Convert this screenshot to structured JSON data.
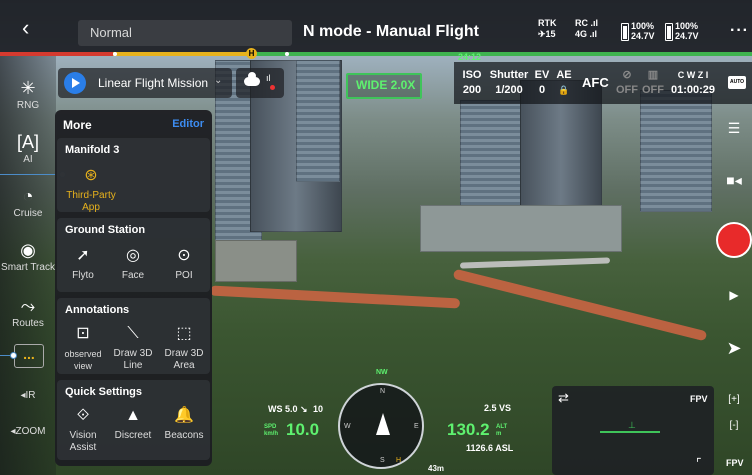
{
  "header": {
    "back_icon": "chevron-left-icon",
    "mode_value": "Normal",
    "flight_mode": "N mode - Manual Flight",
    "rtk_label": "RTK",
    "rtk_count": "15",
    "rc_label": "RC",
    "rc_network": "4G",
    "battery1_pct": "100%",
    "battery1_volt": "24.7V",
    "battery2_pct": "100%",
    "battery2_volt": "24.7V",
    "more_icon": "ellipsis-icon"
  },
  "progress": {
    "home_marker": "H",
    "flight_time": "24:12",
    "segment_colors": [
      "#d63a2f",
      "#e8b21c",
      "#3fb34f"
    ]
  },
  "mission": {
    "label": "Linear Flight Mission",
    "play_icon": "play-icon"
  },
  "camera": {
    "zoom_badge": "WIDE 2.0X",
    "iso_label": "ISO",
    "iso_value": "200",
    "shutter_label": "Shutter",
    "shutter_value": "1/200",
    "ev_label": "EV",
    "ev_value": "0",
    "ae_label": "AE",
    "ae_value": "🔒",
    "af_mode": "AFC",
    "off1": "OFF",
    "off2": "OFF",
    "storage_label": "C W Z I",
    "record_time": "01:00:29",
    "auto_label": "AUTO"
  },
  "left_toolbar": {
    "rng": "RNG",
    "ai": "AI",
    "cruise": "Cruise",
    "smart_track": "Smart Track",
    "routes": "Routes",
    "more_dots": "...",
    "ir": "IR",
    "zoom": "ZOOM"
  },
  "more_panel": {
    "title": "More",
    "editor": "Editor",
    "manifold": {
      "title": "Manifold 3",
      "items": [
        {
          "label": "Third-Party App",
          "icon": "third-party-app-icon"
        }
      ]
    },
    "ground_station": {
      "title": "Ground Station",
      "items": [
        {
          "label": "Flyto",
          "icon": "flyto-icon"
        },
        {
          "label": "Face",
          "icon": "eye-icon"
        },
        {
          "label": "POI",
          "icon": "poi-icon"
        }
      ]
    },
    "annotations": {
      "title": "Annotations",
      "items": [
        {
          "label": "observed view",
          "icon": "observed-view-icon"
        },
        {
          "label": "Draw 3D Line",
          "icon": "draw-line-icon"
        },
        {
          "label": "Draw 3D Area",
          "icon": "draw-area-icon"
        }
      ]
    },
    "quick_settings": {
      "title": "Quick Settings",
      "items": [
        {
          "label": "Vision Assist",
          "icon": "vision-assist-icon"
        },
        {
          "label": "Discreet",
          "icon": "discreet-icon"
        },
        {
          "label": "Beacons",
          "icon": "bell-icon"
        }
      ]
    }
  },
  "hud": {
    "wind": "WS 5.0 ↘",
    "wind_dir": "10",
    "speed_unit": "SPD km/h",
    "speed": "10.0",
    "altitude": "130.2",
    "alt_unit": "ALT m",
    "vs": "2.5 VS",
    "asl": "1126.6 ASL",
    "home_dist": "43m",
    "compass_n": "N",
    "compass_s": "S",
    "compass_e": "E",
    "compass_w": "W",
    "compass_h": "H",
    "small_tag": "NW"
  },
  "fpv": {
    "label": "FPV",
    "label2": "FPV",
    "swap_icon": "swap-icon"
  }
}
